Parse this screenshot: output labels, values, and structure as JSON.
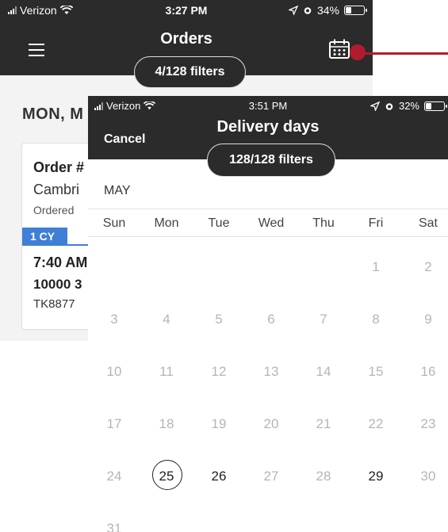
{
  "background_screen": {
    "status": {
      "carrier": "Verizon",
      "time": "3:27 PM",
      "battery": "34%",
      "battery_level": 0.34
    },
    "title": "Orders",
    "filters_pill": "4/128 filters",
    "day_heading": "MON, M",
    "order_card": {
      "title": "Order #",
      "city": "Cambri",
      "ordered": "Ordered",
      "badge": "1 CY",
      "time": "7:40 AM",
      "address": "10000 3",
      "code": "TK8877"
    },
    "annotation_color": "#b01c2e",
    "icons": [
      "menu-icon",
      "calendar-icon"
    ]
  },
  "delivery_screen": {
    "status": {
      "carrier": "Verizon",
      "time": "3:51 PM",
      "battery": "32%",
      "battery_level": 0.32
    },
    "cancel_label": "Cancel",
    "title": "Delivery days",
    "filters_pill": "128/128 filters",
    "month": "MAY",
    "weekdays": [
      "Sun",
      "Mon",
      "Tue",
      "Wed",
      "Thu",
      "Fri",
      "Sat"
    ],
    "weeks": [
      [
        null,
        null,
        null,
        null,
        null,
        "1",
        "2"
      ],
      [
        "3",
        "4",
        "5",
        "6",
        "7",
        "8",
        "9"
      ],
      [
        "10",
        "11",
        "12",
        "13",
        "14",
        "15",
        "16"
      ],
      [
        "17",
        "18",
        "19",
        "20",
        "21",
        "22",
        "23"
      ],
      [
        "24",
        "25",
        "26",
        "27",
        "28",
        "29",
        "30"
      ],
      [
        "31",
        null,
        null,
        null,
        null,
        null,
        null
      ]
    ],
    "today": "25",
    "available_days": [
      "26",
      "29"
    ]
  }
}
